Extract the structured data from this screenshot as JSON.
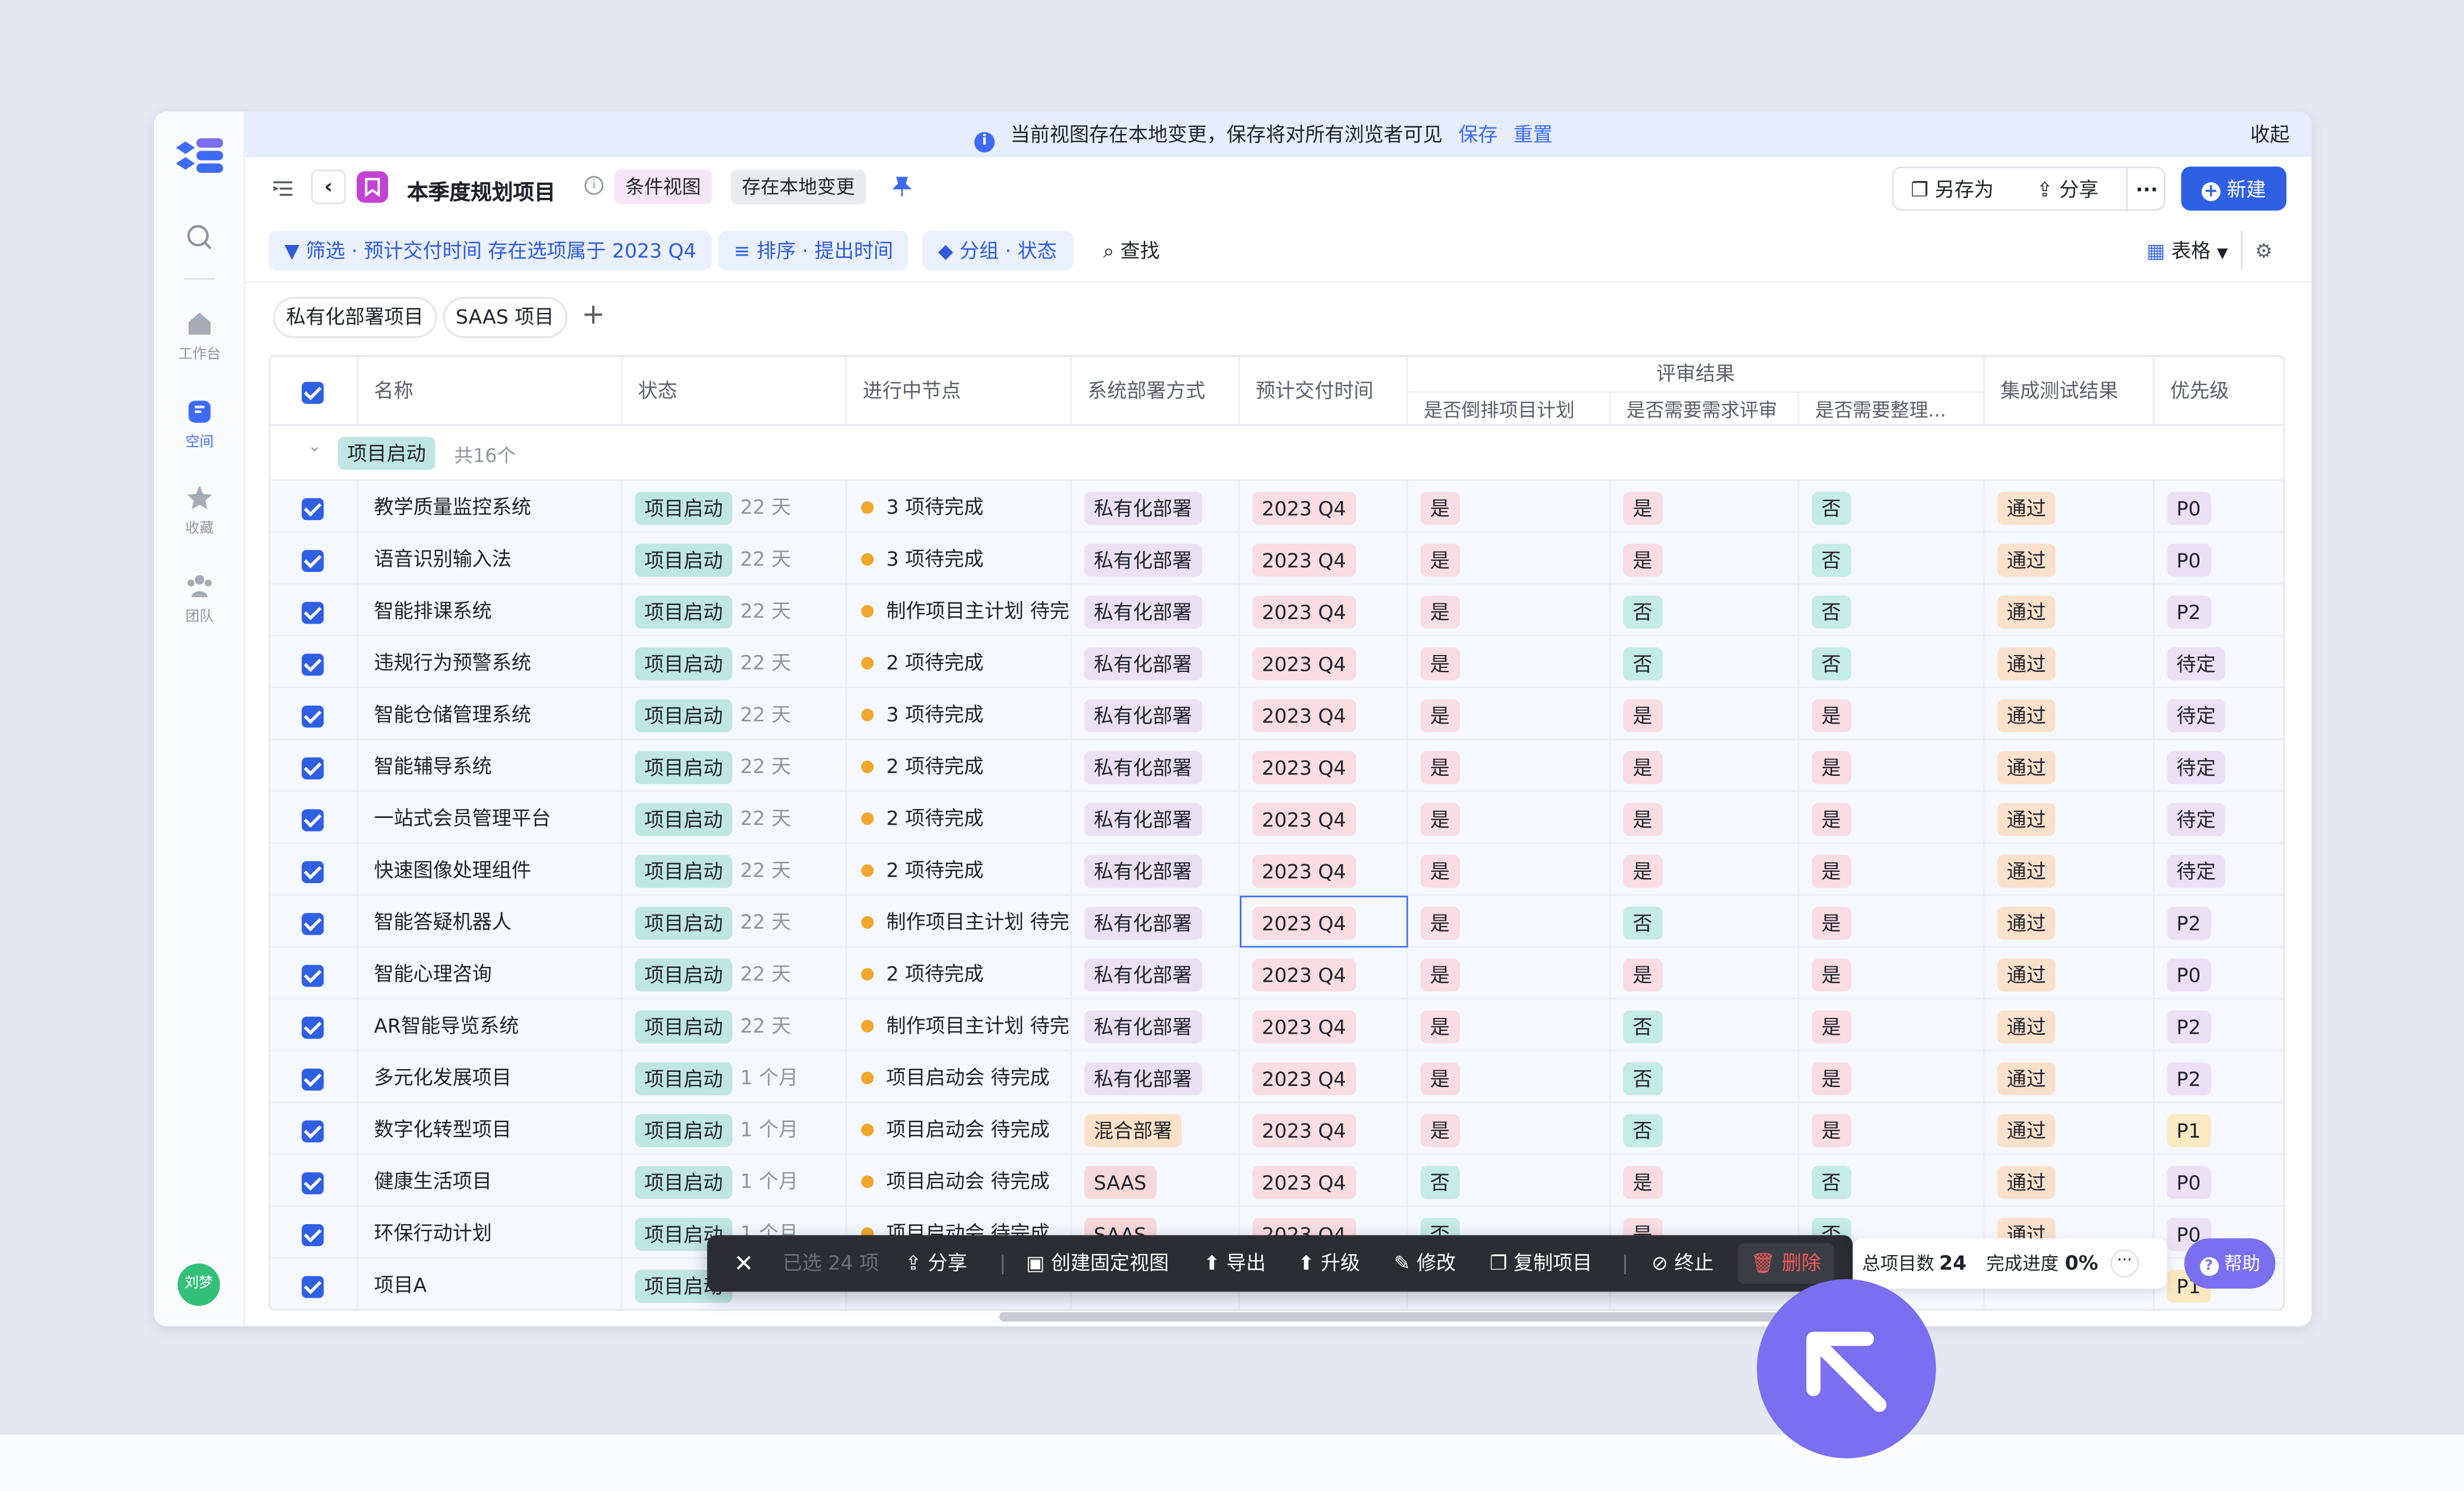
{
  "banner": {
    "message": "当前视图存在本地变更，保存将对所有浏览者可见",
    "save": "保存",
    "reset": "重置",
    "collapse": "收起"
  },
  "sidebar": {
    "items": [
      {
        "label": "",
        "icon": "search-icon"
      },
      {
        "label": "工作台",
        "icon": "home-icon"
      },
      {
        "label": "空间",
        "icon": "space-icon"
      },
      {
        "label": "收藏",
        "icon": "star-icon"
      },
      {
        "label": "团队",
        "icon": "team-icon"
      }
    ],
    "user": "刘梦"
  },
  "header": {
    "title": "本季度规划项目",
    "view_chip": "条件视图",
    "local_chip": "存在本地变更",
    "save_as": "另存为",
    "share": "分享",
    "new": "新建"
  },
  "filters": {
    "filter": "筛选 · 预计交付时间 存在选项属于 2023 Q4",
    "sort": "排序 · 提出时间",
    "group": "分组 · 状态",
    "find": "查找",
    "view_type": "表格"
  },
  "tabs": [
    "私有化部署项目",
    "SAAS 项目"
  ],
  "columns": {
    "name": "名称",
    "status": "状态",
    "node": "进行中节点",
    "deploy": "系统部署方式",
    "delivery": "预计交付时间",
    "review": "评审结果",
    "review_sub": [
      "是否倒排项目计划",
      "是否需要需求评审",
      "是否需要整理..."
    ],
    "test": "集成测试结果",
    "priority": "优先级"
  },
  "group": {
    "label": "项目启动",
    "count": "共16个"
  },
  "rows": [
    {
      "name": "教学质量监控系统",
      "status": "项目启动",
      "dur": "22 天",
      "node": "3 项待完成",
      "deploy": "私有化部署",
      "date": "2023 Q4",
      "r1": "是",
      "r2": "是",
      "r3": "否",
      "test": "通过",
      "pri": "P0"
    },
    {
      "name": "语音识别输入法",
      "status": "项目启动",
      "dur": "22 天",
      "node": "3 项待完成",
      "deploy": "私有化部署",
      "date": "2023 Q4",
      "r1": "是",
      "r2": "是",
      "r3": "否",
      "test": "通过",
      "pri": "P0"
    },
    {
      "name": "智能排课系统",
      "status": "项目启动",
      "dur": "22 天",
      "node": "制作项目主计划 待完",
      "deploy": "私有化部署",
      "date": "2023 Q4",
      "r1": "是",
      "r2": "否",
      "r3": "否",
      "test": "通过",
      "pri": "P2"
    },
    {
      "name": "违规行为预警系统",
      "status": "项目启动",
      "dur": "22 天",
      "node": "2 项待完成",
      "deploy": "私有化部署",
      "date": "2023 Q4",
      "r1": "是",
      "r2": "否",
      "r3": "否",
      "test": "通过",
      "pri": "待定"
    },
    {
      "name": "智能仓储管理系统",
      "status": "项目启动",
      "dur": "22 天",
      "node": "3 项待完成",
      "deploy": "私有化部署",
      "date": "2023 Q4",
      "r1": "是",
      "r2": "是",
      "r3": "是",
      "test": "通过",
      "pri": "待定"
    },
    {
      "name": "智能辅导系统",
      "status": "项目启动",
      "dur": "22 天",
      "node": "2 项待完成",
      "deploy": "私有化部署",
      "date": "2023 Q4",
      "r1": "是",
      "r2": "是",
      "r3": "是",
      "test": "通过",
      "pri": "待定"
    },
    {
      "name": "一站式会员管理平台",
      "status": "项目启动",
      "dur": "22 天",
      "node": "2 项待完成",
      "deploy": "私有化部署",
      "date": "2023 Q4",
      "r1": "是",
      "r2": "是",
      "r3": "是",
      "test": "通过",
      "pri": "待定"
    },
    {
      "name": "快速图像处理组件",
      "status": "项目启动",
      "dur": "22 天",
      "node": "2 项待完成",
      "deploy": "私有化部署",
      "date": "2023 Q4",
      "r1": "是",
      "r2": "是",
      "r3": "是",
      "test": "通过",
      "pri": "待定"
    },
    {
      "name": "智能答疑机器人",
      "status": "项目启动",
      "dur": "22 天",
      "node": "制作项目主计划 待完",
      "deploy": "私有化部署",
      "date": "2023 Q4",
      "r1": "是",
      "r2": "否",
      "r3": "是",
      "test": "通过",
      "pri": "P2"
    },
    {
      "name": "智能心理咨询",
      "status": "项目启动",
      "dur": "22 天",
      "node": "2 项待完成",
      "deploy": "私有化部署",
      "date": "2023 Q4",
      "r1": "是",
      "r2": "是",
      "r3": "是",
      "test": "通过",
      "pri": "P0"
    },
    {
      "name": "AR智能导览系统",
      "status": "项目启动",
      "dur": "22 天",
      "node": "制作项目主计划 待完",
      "deploy": "私有化部署",
      "date": "2023 Q4",
      "r1": "是",
      "r2": "否",
      "r3": "是",
      "test": "通过",
      "pri": "P2"
    },
    {
      "name": "多元化发展项目",
      "status": "项目启动",
      "dur": "1 个月",
      "node": "项目启动会 待完成",
      "deploy": "私有化部署",
      "date": "2023 Q4",
      "r1": "是",
      "r2": "否",
      "r3": "是",
      "test": "通过",
      "pri": "P2"
    },
    {
      "name": "数字化转型项目",
      "status": "项目启动",
      "dur": "1 个月",
      "node": "项目启动会 待完成",
      "deploy": "混合部署",
      "date": "2023 Q4",
      "r1": "是",
      "r2": "否",
      "r3": "是",
      "test": "通过",
      "pri": "P1"
    },
    {
      "name": "健康生活项目",
      "status": "项目启动",
      "dur": "1 个月",
      "node": "项目启动会 待完成",
      "deploy": "SAAS",
      "date": "2023 Q4",
      "r1": "否",
      "r2": "是",
      "r3": "否",
      "test": "通过",
      "pri": "P0"
    },
    {
      "name": "环保行动计划",
      "status": "项目启动",
      "dur": "1 个月",
      "node": "项目启动会 待完成",
      "deploy": "SAAS",
      "date": "2023 Q4",
      "r1": "否",
      "r2": "是",
      "r3": "否",
      "test": "通过",
      "pri": "P0"
    },
    {
      "name": "项目A",
      "status": "项目启动",
      "dur": "",
      "node": "",
      "deploy": "",
      "date": "",
      "r1": "",
      "r2": "",
      "r3": "",
      "test": "",
      "pri": "P1"
    }
  ],
  "toolbar": {
    "selected": "已选 24 项",
    "share": "分享",
    "fixed_view": "创建固定视图",
    "export": "导出",
    "upgrade": "升级",
    "edit": "修改",
    "copy": "复制项目",
    "stop": "终止",
    "delete": "删除"
  },
  "stats": {
    "total_label": "总项目数",
    "total": "24",
    "progress_label": "完成进度",
    "progress": "0%"
  },
  "help": "帮助",
  "colors": {
    "accent": "#2f5fe3",
    "help": "#7a6ff0",
    "toolbar": "#2b2d33",
    "banner": "#e6edfe"
  }
}
